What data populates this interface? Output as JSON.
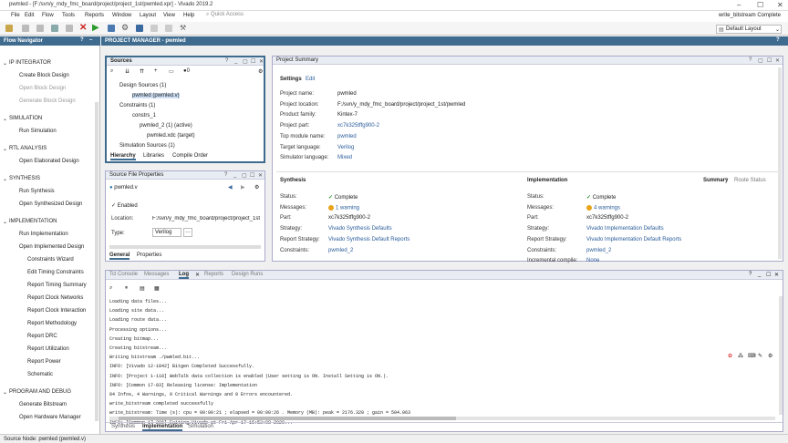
{
  "window": {
    "title": "pwmled - [F:/svn/y_mdy_fmc_board/project/project_1st/pwmled.xpr] - Vivado 2019.2",
    "status_right": "write_bitstream Complete"
  },
  "menu": [
    "File",
    "Edit",
    "Flow",
    "Tools",
    "Reports",
    "Window",
    "Layout",
    "View",
    "Help"
  ],
  "quick_access": {
    "placeholder": "Quick Access"
  },
  "layout": {
    "selected": "Default Layout"
  },
  "flow_navigator": {
    "title": "Flow Navigator",
    "items": [
      {
        "label": "IP INTEGRATOR",
        "type": "section"
      },
      {
        "label": "Create Block Design",
        "type": "item"
      },
      {
        "label": "Open Block Design",
        "type": "disabled"
      },
      {
        "label": "Generate Block Design",
        "type": "disabled"
      },
      {
        "label": "SIMULATION",
        "type": "section"
      },
      {
        "label": "Run Simulation",
        "type": "item"
      },
      {
        "label": "RTL ANALYSIS",
        "type": "section"
      },
      {
        "label": "Open Elaborated Design",
        "type": "item"
      },
      {
        "label": "SYNTHESIS",
        "type": "section"
      },
      {
        "label": "Run Synthesis",
        "type": "item"
      },
      {
        "label": "Open Synthesized Design",
        "type": "item"
      },
      {
        "label": "IMPLEMENTATION",
        "type": "section"
      },
      {
        "label": "Run Implementation",
        "type": "item"
      },
      {
        "label": "Open Implemented Design",
        "type": "item"
      },
      {
        "label": "Constraints Wizard",
        "type": "sub"
      },
      {
        "label": "Edit Timing Constraints",
        "type": "sub"
      },
      {
        "label": "Report Timing Summary",
        "type": "sub"
      },
      {
        "label": "Report Clock Networks",
        "type": "sub"
      },
      {
        "label": "Report Clock Interaction",
        "type": "sub"
      },
      {
        "label": "Report Methodology",
        "type": "sub"
      },
      {
        "label": "Report DRC",
        "type": "sub"
      },
      {
        "label": "Report Utilization",
        "type": "sub"
      },
      {
        "label": "Report Power",
        "type": "sub"
      },
      {
        "label": "Schematic",
        "type": "sub"
      },
      {
        "label": "PROGRAM AND DEBUG",
        "type": "section"
      },
      {
        "label": "Generate Bitstream",
        "type": "item"
      },
      {
        "label": "Open Hardware Manager",
        "type": "item"
      }
    ]
  },
  "project_manager": {
    "title": "PROJECT MANAGER - pwmled"
  },
  "sources": {
    "title": "Sources",
    "tree": [
      "Design Sources (1)",
      "pwmled (pwmled.v)",
      "Constraints (1)",
      "constrs_1",
      "pwmled_2 (1) (active)",
      "pwmled.xdc (target)",
      "Simulation Sources (1)"
    ],
    "tabs": [
      "Hierarchy",
      "Libraries",
      "Compile Order"
    ]
  },
  "source_props": {
    "title": "Source File Properties",
    "file": "pwmled.v",
    "enabled": "Enabled",
    "location_label": "Location:",
    "location": "F:/svn/y_mdy_fmc_board/project/project_1st/src",
    "type_label": "Type:",
    "type": "Verilog",
    "tabs": [
      "General",
      "Properties"
    ]
  },
  "summary": {
    "title": "Project Summary",
    "settings": "Settings",
    "edit": "Edit",
    "rows": [
      {
        "k": "Project name:",
        "v": "pwmled",
        "link": false
      },
      {
        "k": "Project location:",
        "v": "F:/svn/y_mdy_fmc_board/project/project_1st/pwmled",
        "link": false
      },
      {
        "k": "Product family:",
        "v": "Kintex-7",
        "link": false
      },
      {
        "k": "Project part:",
        "v": "xc7k325tffg900-2",
        "link": true
      },
      {
        "k": "Top module name:",
        "v": "pwmled",
        "link": true
      },
      {
        "k": "Target language:",
        "v": "Verilog",
        "link": true
      },
      {
        "k": "Simulator language:",
        "v": "Mixed",
        "link": true
      }
    ],
    "synthesis": {
      "title": "Synthesis",
      "rows": [
        {
          "k": "Status:",
          "v": "Complete",
          "link": false
        },
        {
          "k": "Messages:",
          "v": "1 warning",
          "link": true
        },
        {
          "k": "Part:",
          "v": "xc7k325tffg900-2",
          "link": false
        },
        {
          "k": "Strategy:",
          "v": "Vivado Synthesis Defaults",
          "link": true
        },
        {
          "k": "Report Strategy:",
          "v": "Vivado Synthesis Default Reports",
          "link": true
        },
        {
          "k": "Constraints:",
          "v": "pwmled_2",
          "link": true
        }
      ]
    },
    "implementation": {
      "title": "Implementation",
      "summary_tab": "Summary",
      "route_tab": "Route Status",
      "rows": [
        {
          "k": "Status:",
          "v": "Complete",
          "link": false
        },
        {
          "k": "Messages:",
          "v": "4 warnings",
          "link": true
        },
        {
          "k": "Part:",
          "v": "xc7k325tffg900-2",
          "link": false
        },
        {
          "k": "Strategy:",
          "v": "Vivado Implementation Defaults",
          "link": true
        },
        {
          "k": "Report Strategy:",
          "v": "Vivado Implementation Default Reports",
          "link": true
        },
        {
          "k": "Constraints:",
          "v": "pwmled_2",
          "link": true
        },
        {
          "k": "Incremental compile:",
          "v": "None",
          "link": true
        }
      ]
    }
  },
  "console": {
    "tabs": [
      "Tcl Console",
      "Messages",
      "Log",
      "Reports",
      "Design Runs"
    ],
    "lines": [
      "Loading data files...",
      "Loading site data...",
      "Loading route data...",
      "Processing options...",
      "Creating bitmap...",
      "Creating bitstream...",
      "Writing bitstream ./pwmled.bit...",
      "INFO: [Vivado 12-1842] Bitgen Completed Successfully.",
      "INFO: [Project 1-118] WebTalk data collection is enabled (User setting is ON. Install Setting is ON.).",
      "INFO: [Common 17-83] Releasing license: Implementation",
      "84 Infos, 4 Warnings, 0 Critical Warnings and 0 Errors encountered.",
      "write_bitstream completed successfully",
      "write_bitstream: Time (s): cpu = 00:00:21 ; elapsed = 00:00:26 . Memory (MB): peak = 2176.320 ; gain = 504.063",
      "INFO: [Common 17-206] Exiting Vivado at Fri Apr 17 16:53:08 2020..."
    ],
    "bottom_tabs": [
      "Synthesis",
      "Implementation",
      "Simulation"
    ]
  },
  "status_bar": "Source Node: pwmled (pwmled.v)"
}
